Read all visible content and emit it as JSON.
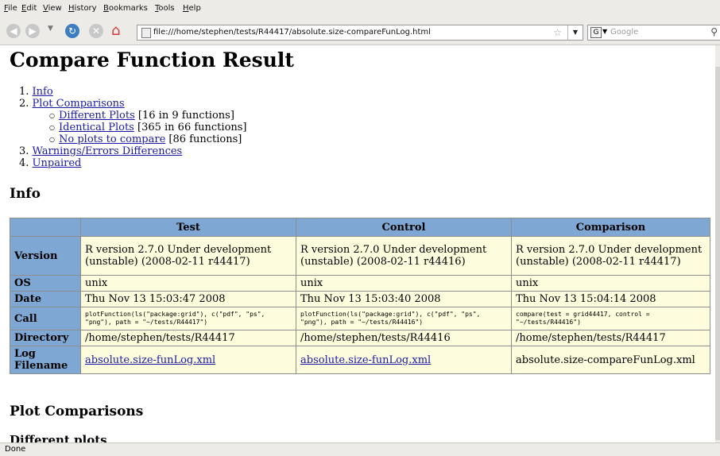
{
  "menu": [
    "File",
    "Edit",
    "View",
    "History",
    "Bookmarks",
    "Tools",
    "Help"
  ],
  "address": {
    "url": "file:///home/stephen/tests/R44417/absolute.size-compareFunLog.html"
  },
  "search": {
    "placeholder": "Google"
  },
  "page": {
    "title": "Compare Function Result",
    "toc": {
      "items": [
        {
          "num": "1.",
          "label": "Info"
        },
        {
          "num": "2.",
          "label": "Plot Comparisons"
        },
        {
          "num": "3.",
          "label": "Warnings/Errors Differences"
        },
        {
          "num": "4.",
          "label": "Unpaired"
        }
      ],
      "subitems": [
        {
          "label": "Different Plots",
          "count": " [16 in 9 functions]"
        },
        {
          "label": "Identical Plots",
          "count": " [365 in 66 functions]"
        },
        {
          "label": "No plots to compare",
          "count": " [86 functions]"
        }
      ]
    },
    "info_heading": "Info",
    "table": {
      "headers": [
        "",
        "Test",
        "Control",
        "Comparison"
      ],
      "rows": [
        {
          "label": "Version",
          "cells": [
            "R version 2.7.0 Under development (unstable) (2008-02-11 r44417)",
            "R version 2.7.0 Under development (unstable) (2008-02-11 r44416)",
            "R version 2.7.0 Under development (unstable) (2008-02-11 r44417)"
          ]
        },
        {
          "label": "OS",
          "cells": [
            "unix",
            "unix",
            "unix"
          ]
        },
        {
          "label": "Date",
          "cells": [
            "Thu Nov 13 15:03:47 2008",
            "Thu Nov 13 15:03:40 2008",
            "Thu Nov 13 15:04:14 2008"
          ]
        },
        {
          "label": "Call",
          "cells": [
            "plotFunction(ls(\"package:grid\"), c(\"pdf\", \"ps\", \"png\"), path = \"~/tests/R44417\")",
            "plotFunction(ls(\"package:grid\"), c(\"pdf\", \"ps\", \"png\"), path = \"~/tests/R44416\")",
            "compare(test = grid44417, control = \"~/tests/R44416\")"
          ]
        },
        {
          "label": "Directory",
          "cells": [
            "/home/stephen/tests/R44417",
            "/home/stephen/tests/R44416",
            "/home/stephen/tests/R44417"
          ]
        },
        {
          "label": "Log Filename",
          "cells": [
            "absolute.size-funLog.xml",
            "absolute.size-funLog.xml",
            "absolute.size-compareFunLog.xml"
          ]
        }
      ]
    },
    "plot_heading": "Plot Comparisons",
    "different_heading": "Different plots"
  },
  "status": "Done"
}
